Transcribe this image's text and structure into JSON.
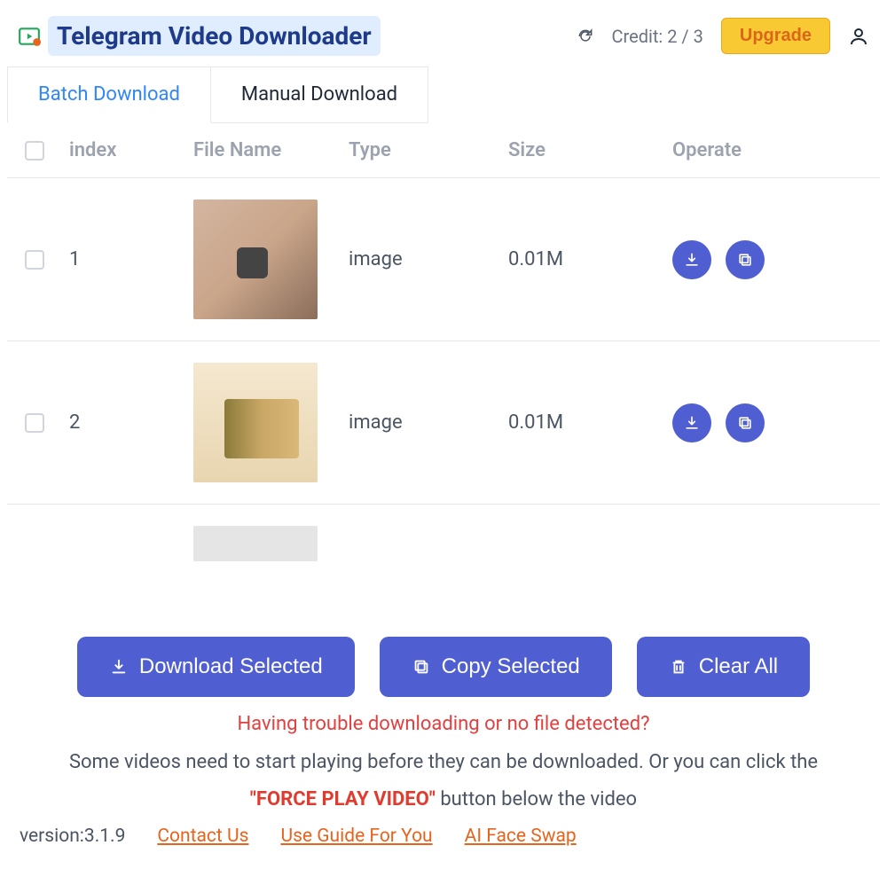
{
  "header": {
    "title": "Telegram Video Downloader",
    "credit_label": "Credit: 2 / 3",
    "upgrade_label": "Upgrade"
  },
  "tabs": {
    "batch": "Batch Download",
    "manual": "Manual Download",
    "active": "batch"
  },
  "table": {
    "headers": {
      "index": "index",
      "filename": "File Name",
      "type": "Type",
      "size": "Size",
      "operate": "Operate"
    },
    "rows": [
      {
        "index": "1",
        "type": "image",
        "size": "0.01M"
      },
      {
        "index": "2",
        "type": "image",
        "size": "0.01M"
      }
    ]
  },
  "actions": {
    "download_selected": "Download Selected",
    "copy_selected": "Copy Selected",
    "clear_all": "Clear All"
  },
  "help": {
    "title": "Having trouble downloading or no file detected?",
    "text_before": "Some videos need to start playing before they can be downloaded. Or you can click the ",
    "force_play": "\"FORCE PLAY VIDEO\"",
    "text_after": " button below the video"
  },
  "footer": {
    "version": "version:3.1.9",
    "contact": "Contact Us",
    "guide": "Use Guide For You",
    "faceswap": "AI Face Swap"
  }
}
